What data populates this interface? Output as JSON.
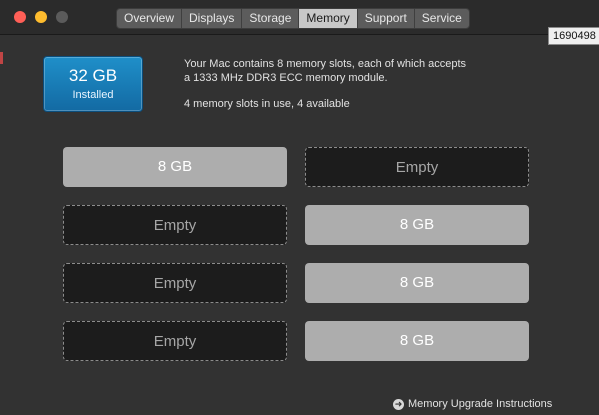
{
  "tabs": [
    "Overview",
    "Displays",
    "Storage",
    "Memory",
    "Support",
    "Service"
  ],
  "active_tab": "Memory",
  "tooltip": "1690498",
  "installed": {
    "size": "32 GB",
    "label": "Installed"
  },
  "description": {
    "line1": "Your Mac contains 8 memory slots, each of which accepts",
    "line2": "a 1333 MHz DDR3 ECC memory module.",
    "usage": "4 memory slots in use, 4 available"
  },
  "slots": {
    "s1": "8 GB",
    "s2": "Empty",
    "s3": "Empty",
    "s4": "8 GB",
    "s5": "Empty",
    "s6": "8 GB",
    "s7": "Empty",
    "s8": "8 GB"
  },
  "upgrade_link": "Memory Upgrade Instructions",
  "colors": {
    "accent": "#1f8fc9",
    "filled_slot": "#adadad",
    "empty_slot": "#1c1c1c"
  }
}
